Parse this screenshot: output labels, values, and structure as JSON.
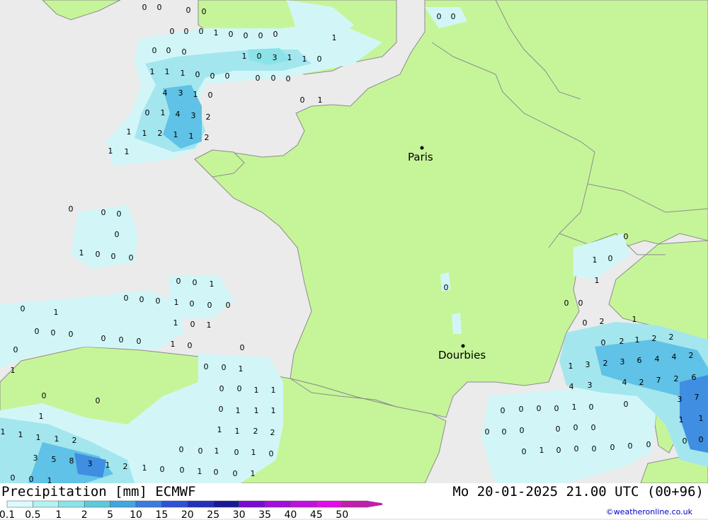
{
  "header": {
    "title": "Precipitation [mm] ECMWF",
    "datetime": "Mo 20-01-2025 21.00 UTC (00+96)",
    "credit": "©weatheronline.co.uk"
  },
  "legend": {
    "ticks": [
      "0.1",
      "0.5",
      "1",
      "2",
      "5",
      "10",
      "15",
      "20",
      "25",
      "30",
      "35",
      "40",
      "45",
      "50"
    ],
    "colors": [
      "#dbfbfc",
      "#b4f1f3",
      "#8ae3e8",
      "#5fc9dc",
      "#41a6e0",
      "#3b7be0",
      "#3050d8",
      "#2230bb",
      "#1a1a98",
      "#7a0cd2",
      "#a30ddb",
      "#c010e0",
      "#e20ce8",
      "#c020a8"
    ]
  },
  "colors": {
    "land": "#c6f599",
    "sea": "#ebebeb",
    "border": "#8c8c8c",
    "precip_light": "#d2f6f8",
    "precip_mid": "#a4e6ee",
    "precip_heavy": "#5fc2e6",
    "precip_heavier": "#3f8ee2"
  },
  "cities": [
    {
      "name": "Paris"
    },
    {
      "name": "Dourbies"
    }
  ],
  "precip_values": [
    "0",
    "0",
    "0",
    "0",
    "0",
    "0",
    "0",
    "1",
    "0",
    "0",
    "0",
    "0",
    "1",
    "0",
    "0",
    "0",
    "1",
    "0",
    "3",
    "1",
    "1",
    "0",
    "0",
    "0",
    "0",
    "1",
    "1",
    "1",
    "0",
    "0",
    "0",
    "0",
    "0",
    "0",
    "1",
    "4",
    "3",
    "1",
    "0",
    "0",
    "1",
    "4",
    "3",
    "2",
    "1",
    "1",
    "2",
    "1",
    "1",
    "2",
    "1",
    "1",
    "0",
    "0",
    "0",
    "0",
    "1",
    "0",
    "0",
    "0",
    "0",
    "0",
    "1",
    "0",
    "0",
    "0",
    "1",
    "0",
    "0",
    "0",
    "0",
    "1",
    "1",
    "0",
    "1",
    "0",
    "0",
    "0",
    "0",
    "0",
    "0",
    "1",
    "0",
    "0",
    "0",
    "1",
    "0",
    "0",
    "1",
    "0",
    "0",
    "0",
    "0",
    "1",
    "1",
    "1",
    "0",
    "1",
    "1",
    "1",
    "1",
    "1",
    "1",
    "1",
    "2",
    "1",
    "1",
    "2",
    "2",
    "3",
    "5",
    "8",
    "3",
    "1",
    "2",
    "1",
    "0",
    "0",
    "0",
    "1",
    "0",
    "1",
    "0",
    "0",
    "0",
    "1",
    "0",
    "1",
    "0",
    "0",
    "1",
    "0",
    "0",
    "1",
    "0",
    "1",
    "0",
    "0",
    "0",
    "2",
    "1",
    "0",
    "2",
    "1",
    "2",
    "2",
    "3",
    "2",
    "3",
    "6",
    "4",
    "4",
    "2",
    "1",
    "4",
    "3",
    "4",
    "2",
    "7",
    "2",
    "6",
    "3",
    "7",
    "1",
    "1",
    "0",
    "0",
    "0",
    "0",
    "0",
    "0",
    "0",
    "1",
    "0",
    "0",
    "0",
    "0",
    "0",
    "0",
    "0",
    "0",
    "1",
    "0",
    "0",
    "0",
    "0",
    "0",
    "0"
  ]
}
